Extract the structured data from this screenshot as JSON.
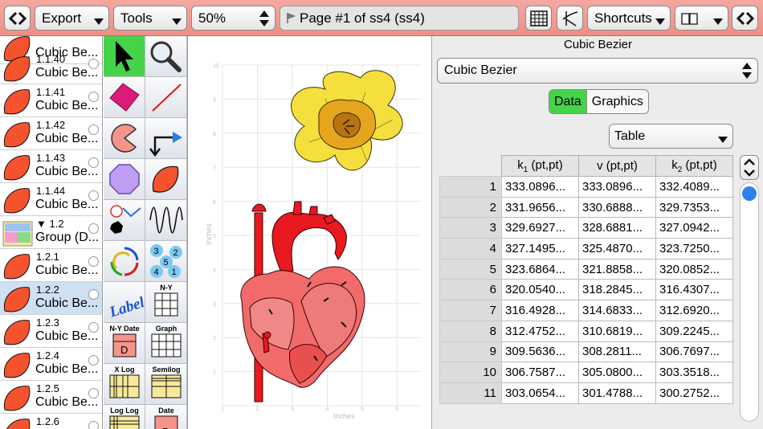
{
  "toolbar": {
    "export_label": "Export",
    "tools_label": "Tools",
    "zoom_value": "50%",
    "page_label": "Page #1 of ss4 (ss4)",
    "shortcuts_label": "Shortcuts"
  },
  "outline": {
    "items": [
      {
        "num": "",
        "name": "Cubic Be..."
      },
      {
        "num": "1.1.40",
        "name": "Cubic Be..."
      },
      {
        "num": "1.1.41",
        "name": "Cubic Be..."
      },
      {
        "num": "1.1.42",
        "name": "Cubic Be..."
      },
      {
        "num": "1.1.43",
        "name": "Cubic Be..."
      },
      {
        "num": "1.1.44",
        "name": "Cubic Be..."
      },
      {
        "num": "▼ 1.2",
        "name": "Group (D..."
      },
      {
        "num": "1.2.1",
        "name": "Cubic Be..."
      },
      {
        "num": "1.2.2",
        "name": "Cubic Be..."
      },
      {
        "num": "1.2.3",
        "name": "Cubic Be..."
      },
      {
        "num": "1.2.4",
        "name": "Cubic Be..."
      },
      {
        "num": "1.2.5",
        "name": "Cubic Be..."
      },
      {
        "num": "1.2.6",
        "name": ""
      }
    ]
  },
  "palette": {
    "label_tool": "Label",
    "ny_tool": "N-Y",
    "nydate_tool": "N-Y Date",
    "nydate_letter": "D",
    "graph_tool": "Graph",
    "xlog_tool": "X Log",
    "semilog_tool": "Semilog",
    "loglog_tool": "Log Log",
    "date_tool": "Date",
    "date_letter": "D",
    "bubbles": [
      "3",
      "2",
      "5",
      "4",
      "1"
    ]
  },
  "canvas": {
    "y_axis_label": "Inches",
    "x_axis_label": "Inches",
    "y_ticks": [
      "10",
      "9",
      "8",
      "7",
      "6",
      "5",
      "4",
      "3",
      "2",
      "1"
    ],
    "x_ticks": [
      "1",
      "2",
      "3",
      "4",
      "5",
      "6"
    ]
  },
  "inspector": {
    "title": "Cubic Bezier",
    "type_select": "Cubic Bezier",
    "tab_data": "Data",
    "tab_graphics": "Graphics",
    "view_select": "Table",
    "columns": [
      {
        "main": "k",
        "sub": "1",
        "unit": " (pt,pt)"
      },
      {
        "main": "v",
        "sub": "",
        "unit": " (pt,pt)"
      },
      {
        "main": "k",
        "sub": "2",
        "unit": " (pt,pt)"
      }
    ],
    "rows": [
      {
        "n": "1",
        "k1": "333.0896...",
        "v": "333.0896...",
        "k2": "332.4089..."
      },
      {
        "n": "2",
        "k1": "331.9656...",
        "v": "330.6888...",
        "k2": "329.7353..."
      },
      {
        "n": "3",
        "k1": "329.6927...",
        "v": "328.6881...",
        "k2": "327.0942..."
      },
      {
        "n": "4",
        "k1": "327.1495...",
        "v": "325.4870...",
        "k2": "323.7250..."
      },
      {
        "n": "5",
        "k1": "323.6864...",
        "v": "321.8858...",
        "k2": "320.0852..."
      },
      {
        "n": "6",
        "k1": "320.0540...",
        "v": "318.2845...",
        "k2": "316.4307..."
      },
      {
        "n": "7",
        "k1": "316.4928...",
        "v": "314.6833...",
        "k2": "312.6920..."
      },
      {
        "n": "8",
        "k1": "312.4752...",
        "v": "310.6819...",
        "k2": "309.2245..."
      },
      {
        "n": "9",
        "k1": "309.5636...",
        "v": "308.2811...",
        "k2": "306.7697..."
      },
      {
        "n": "10",
        "k1": "306.7587...",
        "v": "305.0800...",
        "k2": "303.3518..."
      },
      {
        "n": "11",
        "k1": "303.0654...",
        "v": "301.4788...",
        "k2": "300.2752..."
      }
    ]
  },
  "colors": {
    "toolbar": "#ee8f86",
    "accent_green": "#45d34a",
    "heart_red": "#e8191f",
    "daffodil_yellow": "#f5df3c",
    "scroll_blue": "#2e7ff0"
  }
}
